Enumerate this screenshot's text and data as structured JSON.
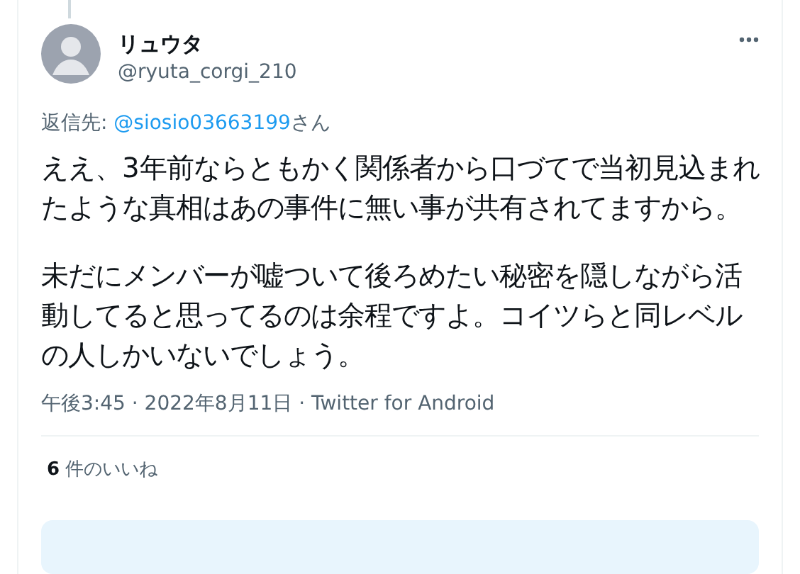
{
  "tweet": {
    "display_name": "リュウタ",
    "handle": "@ryuta_corgi_210",
    "reply_to": {
      "label": "返信先: ",
      "mention": "@siosio03663199",
      "suffix": "さん"
    },
    "paragraphs": [
      "ええ、3年前ならともかく関係者から口づてで当初見込まれたような真相はあの事件に無い事が共有されてますから。",
      "未だにメンバーが嘘ついて後ろめたい秘密を隠しながら活動してると思ってるのは余程ですよ。コイツらと同レベルの人しかいないでしょう。"
    ],
    "meta": "午後3:45 · 2022年8月11日 · Twitter for Android",
    "likes": {
      "count": "6",
      "label": "件のいいね"
    }
  }
}
